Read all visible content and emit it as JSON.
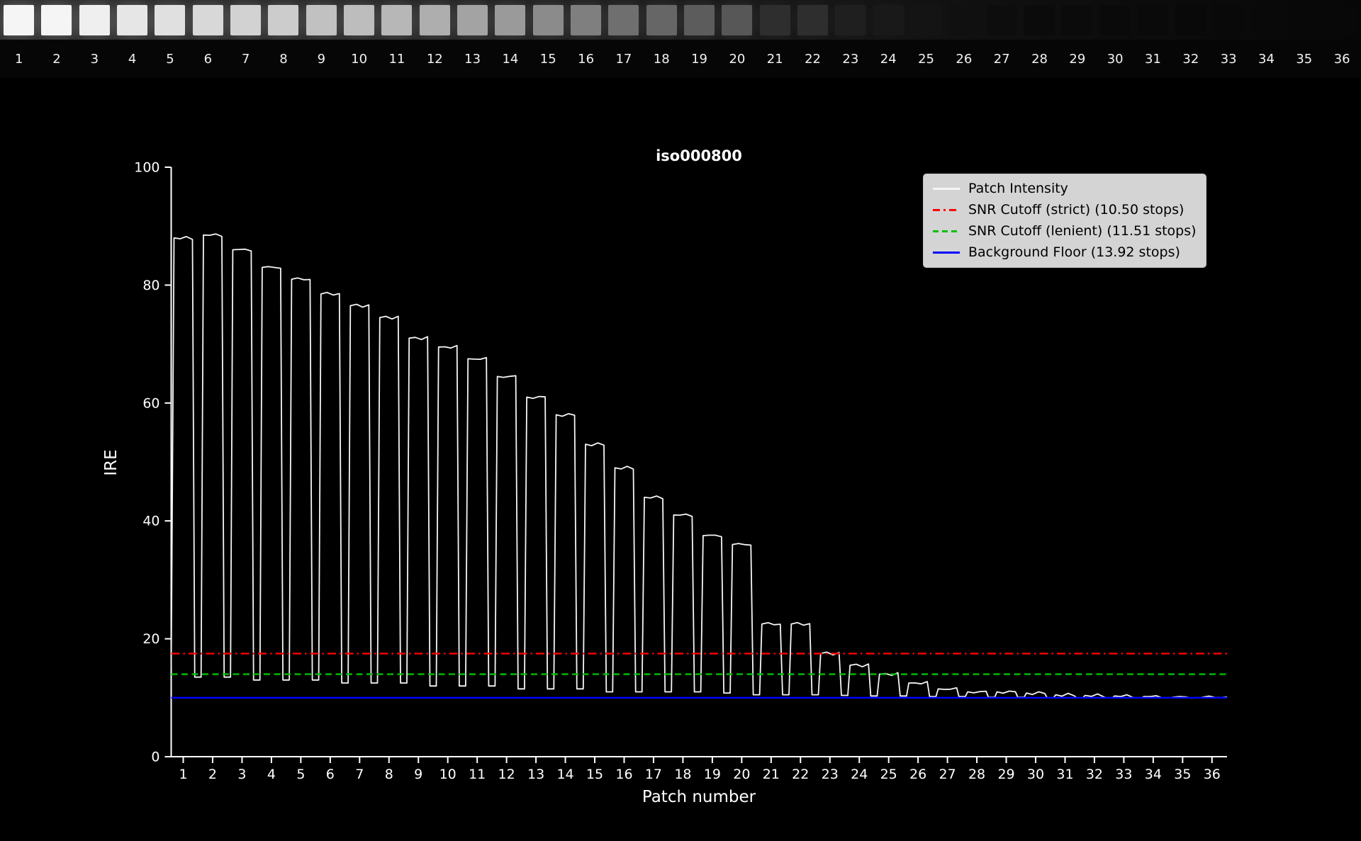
{
  "chart_data": {
    "type": "line",
    "title": "iso000800",
    "xlabel": "Patch number",
    "ylabel": "IRE",
    "ylim": [
      0,
      100
    ],
    "yticks": [
      0,
      20,
      40,
      60,
      80,
      100
    ],
    "categories": [
      1,
      2,
      3,
      4,
      5,
      6,
      7,
      8,
      9,
      10,
      11,
      12,
      13,
      14,
      15,
      16,
      17,
      18,
      19,
      20,
      21,
      22,
      23,
      24,
      25,
      26,
      27,
      28,
      29,
      30,
      31,
      32,
      33,
      34,
      35,
      36
    ],
    "series": [
      {
        "name": "Patch Intensity",
        "color": "#f5f5f5",
        "style": "solid",
        "values": [
          88,
          88.5,
          86,
          83,
          81,
          78.5,
          76.5,
          74.5,
          71,
          69.5,
          67.5,
          64.5,
          61,
          58,
          53,
          49,
          44,
          41,
          37.5,
          36,
          22.5,
          22.5,
          17.5,
          15.5,
          14,
          12.5,
          11.5,
          11,
          11,
          10.8,
          10.5,
          10.4,
          10.3,
          10.2,
          10.1,
          10.1
        ]
      }
    ],
    "valleys": [
      13.5,
      13.5,
      13,
      13,
      13,
      12.5,
      12.5,
      12.5,
      12,
      12,
      12,
      11.5,
      11.5,
      11.5,
      11,
      11,
      11,
      11,
      10.8,
      10.5,
      10.5,
      10.5,
      10.4,
      10.3,
      10.3,
      10.2,
      10.2,
      10.1,
      10.1,
      10,
      10,
      10,
      10,
      10,
      10
    ],
    "reference_lines": [
      {
        "label": "SNR Cutoff (strict) (10.50 stops)",
        "value": 17.5,
        "color": "#ff0000",
        "style": "dashdot"
      },
      {
        "label": "SNR Cutoff (lenient) (11.51 stops)",
        "value": 14,
        "color": "#00c000",
        "style": "dashed"
      },
      {
        "label": "Background Floor (13.92 stops)",
        "value": 10,
        "color": "#0000ff",
        "style": "solid"
      }
    ],
    "legend": {
      "position": "upper right",
      "items": [
        {
          "label": "Patch Intensity",
          "color": "#f5f5f5",
          "style": "solid"
        },
        {
          "label": "SNR Cutoff (strict) (10.50 stops)",
          "color": "#ff0000",
          "style": "dashdot"
        },
        {
          "label": "SNR Cutoff (lenient) (11.51 stops)",
          "color": "#00c000",
          "style": "dashed"
        },
        {
          "label": "Background Floor (13.92 stops)",
          "color": "#0000ff",
          "style": "solid"
        }
      ]
    }
  }
}
